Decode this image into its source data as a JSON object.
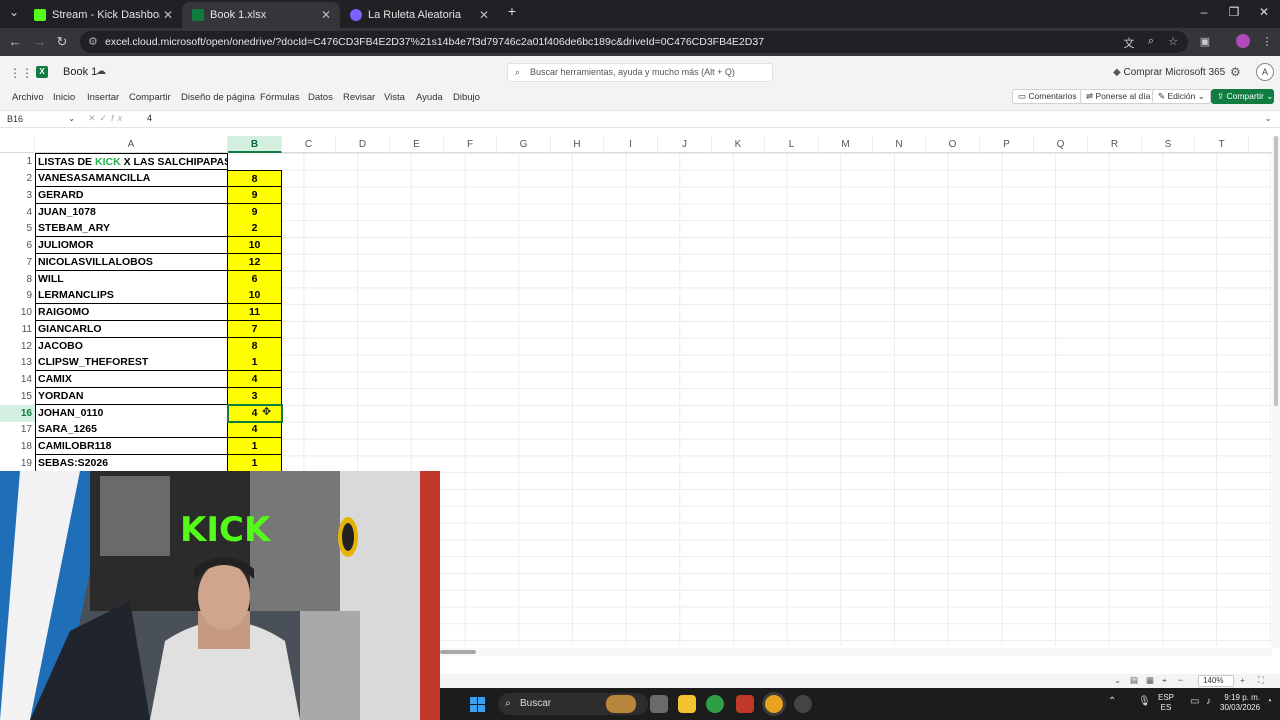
{
  "browser": {
    "tabs": [
      {
        "label": "Stream - Kick Dashboard",
        "favicon_color": "#53fc18",
        "active": false
      },
      {
        "label": "Book 1.xlsx",
        "favicon_color": "#107c41",
        "active": true
      },
      {
        "label": "La Ruleta Aleatoria",
        "favicon_color": "#7b61ff",
        "active": false
      }
    ],
    "url": "excel.cloud.microsoft/open/onedrive/?docId=C476CD3FB4E2D37%21s14b4e7f3d79746c2a01f406de6bc189c&driveId=0C476CD3FB4E2D37"
  },
  "excel": {
    "book_name": "Book 1",
    "search_placeholder": "Buscar herramientas, ayuda y mucho más (Alt + Q)",
    "buy_label": "Comprar Microsoft 365",
    "account_initial": "A",
    "menu": [
      "Archivo",
      "Inicio",
      "Insertar",
      "Compartir",
      "Diseño de página",
      "Fórmulas",
      "Datos",
      "Revisar",
      "Vista",
      "Ayuda",
      "Dibujo"
    ],
    "comments_label": "Comentarios",
    "catchup_label": "Ponerse al día",
    "edit_label": "Edición",
    "share_label": "Compartir",
    "name_box": "B16",
    "formula_value": "4",
    "columns": [
      "A",
      "B",
      "C",
      "D",
      "E",
      "F",
      "G",
      "H",
      "I",
      "J",
      "K",
      "L",
      "M",
      "N",
      "O",
      "P",
      "Q",
      "R",
      "S",
      "T"
    ],
    "selected_column": "B",
    "selected_row": 16,
    "title_cell": {
      "pre": "LISTAS DE ",
      "highlight": "KICK",
      "post": " X LAS SALCHIPAPAS:",
      "highlight_color": "#22b14c"
    },
    "rows": [
      {
        "row": 2,
        "name": "VANESASAMANCILLA",
        "value": "8"
      },
      {
        "row": 3,
        "name": "GERARD",
        "value": "9"
      },
      {
        "row": 4,
        "name": "JUAN_1078",
        "value": "9"
      },
      {
        "row": 5,
        "name": "STEBAM_ARY",
        "value": "2"
      },
      {
        "row": 6,
        "name": "JULIOMOR",
        "value": "10"
      },
      {
        "row": 7,
        "name": "NICOLASVILLALOBOS",
        "value": "12"
      },
      {
        "row": 8,
        "name": "WILL",
        "value": "6"
      },
      {
        "row": 9,
        "name": "LERMANCLIPS",
        "value": "10"
      },
      {
        "row": 10,
        "name": "RAIGOMO",
        "value": "11"
      },
      {
        "row": 11,
        "name": "GIANCARLO",
        "value": "7"
      },
      {
        "row": 12,
        "name": "JACOBO",
        "value": "8"
      },
      {
        "row": 13,
        "name": "CLIPSW_THEFOREST",
        "value": "1"
      },
      {
        "row": 14,
        "name": "CAMIX",
        "value": "4"
      },
      {
        "row": 15,
        "name": "YORDAN",
        "value": "3"
      },
      {
        "row": 16,
        "name": "JOHAN_0110",
        "value": "4"
      },
      {
        "row": 17,
        "name": "SARA_1265",
        "value": "4"
      },
      {
        "row": 18,
        "name": "CAMILOBR118",
        "value": "1"
      },
      {
        "row": 19,
        "name": "SEBAS:S2026",
        "value": "1"
      }
    ],
    "highlight_fill": "#ffff00",
    "zoom": "140%"
  },
  "webcam": {
    "sign_text": "KICK",
    "sign_color": "#53fc18"
  },
  "taskbar": {
    "search_label": "Buscar",
    "lang_top": "ESP",
    "lang_bottom": "ES",
    "time": "9:19 p. m.",
    "date": "30/03/2026"
  }
}
